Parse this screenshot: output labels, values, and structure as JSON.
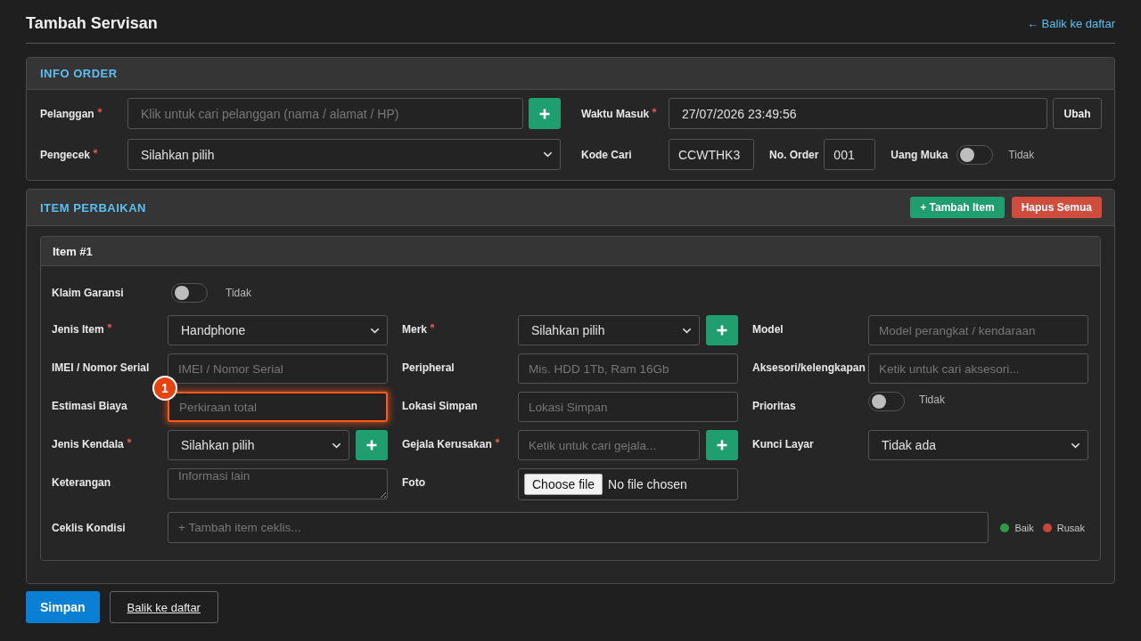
{
  "header": {
    "title": "Tambah Servisan",
    "back_link": "← Balik ke daftar"
  },
  "info_order": {
    "title": "INFO ORDER",
    "customer": {
      "label": "Pelanggan",
      "required": true,
      "placeholder": "Klik untuk cari pelanggan (nama / alamat / HP)",
      "add_button": true
    },
    "entry_time": {
      "label": "Waktu Masuk",
      "required": true,
      "value": "27/07/2026 23:49:56",
      "button": "Ubah"
    },
    "checker": {
      "label": "Pengecek",
      "required": true,
      "value": "Silahkan pilih"
    },
    "search_code": {
      "label": "Kode Cari",
      "required": false,
      "value": "CCWTHK3"
    },
    "order_no": {
      "label": "No. Order",
      "required": false,
      "value": "001"
    },
    "down_payment": {
      "label": "Uang Muka",
      "required": false,
      "on": false,
      "state_text": "Tidak"
    }
  },
  "repair_items": {
    "title": "ITEM PERBAIKAN",
    "actions": [
      {
        "label": "+ Tambah Item",
        "kind": "add"
      },
      {
        "label": "Hapus Semua",
        "kind": "danger"
      }
    ],
    "items": [
      {
        "title": "Item #1",
        "warranty": {
          "label": "Klaim Garansi",
          "on": false,
          "state_text": "Tidak"
        },
        "fields": [
          {
            "label": "Jenis Item",
            "required": true,
            "kind": "select",
            "value": "Handphone",
            "add_button": false
          },
          {
            "label": "Merk",
            "required": true,
            "kind": "select",
            "value": "Silahkan pilih",
            "add_button": true
          },
          {
            "label": "Model",
            "required": false,
            "kind": "input",
            "placeholder": "Model perangkat / kendaraan",
            "add_button": false
          },
          {
            "label": "IMEI / Nomor Serial",
            "required": false,
            "kind": "input",
            "placeholder": "IMEI / Nomor Serial",
            "add_button": false
          },
          {
            "label": "Peripheral",
            "required": false,
            "kind": "input",
            "placeholder": "Mis. HDD 1Tb, Ram 16Gb",
            "add_button": false
          },
          {
            "label": "Aksesori/kelengkapan",
            "required": false,
            "kind": "input",
            "placeholder": "Ketik untuk cari aksesori...",
            "add_button": false
          },
          {
            "label": "Estimasi Biaya",
            "required": false,
            "kind": "input",
            "placeholder": "Perkiraan total",
            "add_button": false,
            "callout": "1"
          },
          {
            "label": "Lokasi Simpan",
            "required": false,
            "kind": "input",
            "placeholder": "Lokasi Simpan",
            "add_button": false
          },
          {
            "label": "Prioritas",
            "required": false,
            "kind": "toggle",
            "on": false,
            "state_text": "Tidak",
            "add_button": false
          },
          {
            "label": "Jenis Kendala",
            "required": true,
            "kind": "select",
            "value": "Silahkan pilih",
            "add_button": true
          },
          {
            "label": "Gejala Kerusakan",
            "required": true,
            "kind": "input",
            "placeholder": "Ketik untuk cari gejala...",
            "add_button": true
          },
          {
            "label": "Kunci Layar",
            "required": false,
            "kind": "select",
            "value": "Tidak ada",
            "add_button": false
          },
          {
            "label": "Keterangan",
            "required": false,
            "kind": "textarea",
            "placeholder": "Informasi lain",
            "add_button": false
          },
          {
            "label": "Foto",
            "required": false,
            "kind": "file",
            "button_label": "Choose file",
            "value": "No file chosen",
            "add_button": false
          }
        ],
        "checklist": {
          "label": "Ceklis Kondisi",
          "placeholder": "+ Tambah item ceklis...",
          "legend": [
            {
              "label": "Baik",
              "color": "#2e9b48"
            },
            {
              "label": "Rusak",
              "color": "#c9463d"
            }
          ]
        }
      }
    ]
  },
  "footer": {
    "actions": [
      {
        "label": "Simpan",
        "kind": "primary"
      },
      {
        "label": "Balik ke daftar",
        "kind": "outline"
      }
    ]
  }
}
